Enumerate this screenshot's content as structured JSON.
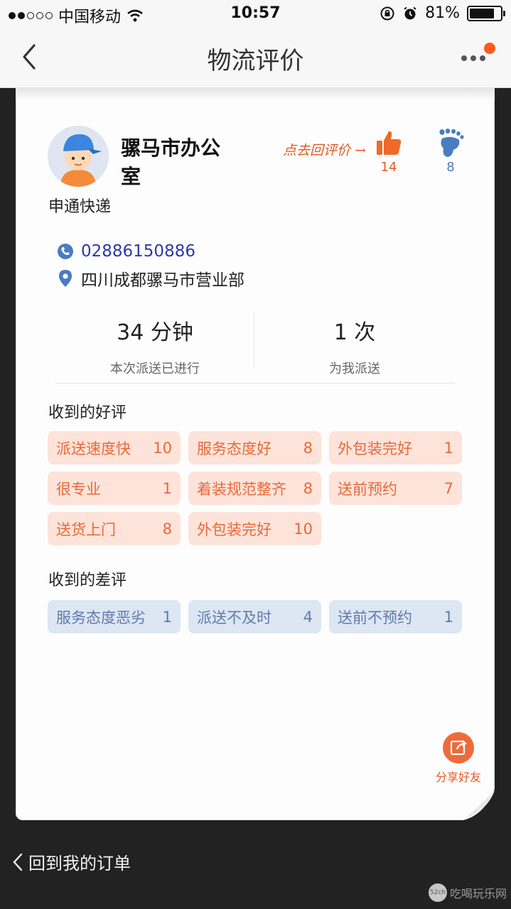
{
  "status_bar": {
    "carrier": "中国移动",
    "time": "10:57",
    "battery": "81%",
    "battery_level": 0.81
  },
  "nav": {
    "title": "物流评价"
  },
  "courier": {
    "name": "骡马市办公室",
    "company": "申通快递",
    "hint": "点去回评价 →",
    "likes": "14",
    "footprints": "8",
    "phone": "02886150886",
    "address": "四川成都骡马市营业部"
  },
  "stats": {
    "duration_value": "34 分钟",
    "duration_label": "本次派送已进行",
    "count_value": "1 次",
    "count_label": "为我派送"
  },
  "good_reviews": {
    "title": "收到的好评",
    "tags": [
      {
        "label": "派送速度快",
        "count": "10"
      },
      {
        "label": "服务态度好",
        "count": "8"
      },
      {
        "label": "外包装完好",
        "count": "1"
      },
      {
        "label": "很专业",
        "count": "1"
      },
      {
        "label": "着装规范整齐",
        "count": "8"
      },
      {
        "label": "送前预约",
        "count": "7"
      },
      {
        "label": "送货上门",
        "count": "8"
      },
      {
        "label": "外包装完好",
        "count": "10"
      }
    ]
  },
  "bad_reviews": {
    "title": "收到的差评",
    "tags": [
      {
        "label": "服务态度恶劣",
        "count": "1"
      },
      {
        "label": "派送不及时",
        "count": "4"
      },
      {
        "label": "送前不预约",
        "count": "1"
      }
    ]
  },
  "share": {
    "label": "分享好友"
  },
  "footer": {
    "back_label": "回到我的订单"
  },
  "watermark": {
    "badge": "52ch",
    "text": "吃喝玩乐网"
  },
  "colors": {
    "accent": "#e35b24",
    "good_tag_bg": "#fde3d9",
    "bad_tag_bg": "#dde6f3",
    "phone": "#2a3aa6"
  }
}
